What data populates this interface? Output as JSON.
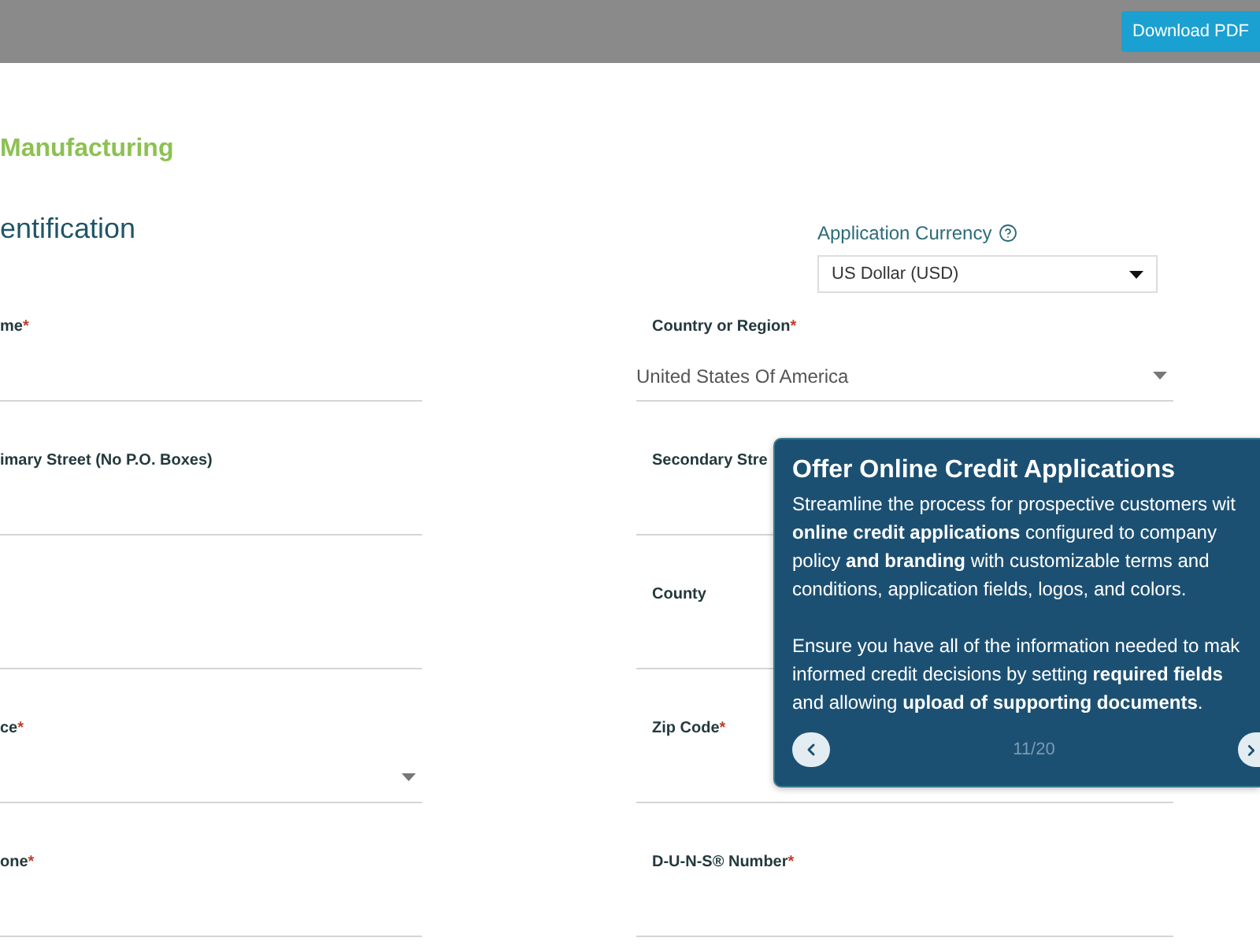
{
  "top_bar": {
    "download_button": "Download PDF"
  },
  "company_name": "Manufacturing",
  "section_title": "entification",
  "currency": {
    "label": "Application Currency",
    "value": "US Dollar (USD)"
  },
  "fields": [
    {
      "label": "me",
      "required_mark": "*",
      "kind": "text"
    },
    {
      "label": "Country or Region",
      "required_mark": "*",
      "kind": "select",
      "value": "United States Of America"
    },
    {
      "label": "imary Street (No P.O. Boxes)",
      "kind": "text"
    },
    {
      "label": "Secondary Stre",
      "kind": "text"
    },
    {
      "kind": "text"
    },
    {
      "label": "County",
      "kind": "text"
    },
    {
      "label": "ce",
      "required_mark": "*",
      "kind": "select"
    },
    {
      "label": "Zip Code",
      "required_mark": "*",
      "kind": "text"
    },
    {
      "label": "one",
      "required_mark": "*",
      "kind": "text"
    },
    {
      "label": "D-U-N-S® Number",
      "required_mark": "*",
      "kind": "text"
    }
  ],
  "tour_popover": {
    "title": "Offer Online Credit Applications",
    "paragraphs": [
      "Streamline the process for prospective customers wit\n**online credit applications** configured to company\npolicy **and branding** with customizable terms and\nconditions, application fields, logos, and colors.",
      "Ensure you have all of the information needed to mak\ninformed credit decisions by setting **required fields**\nand allowing **upload of supporting documents**."
    ],
    "step": "11/20"
  }
}
